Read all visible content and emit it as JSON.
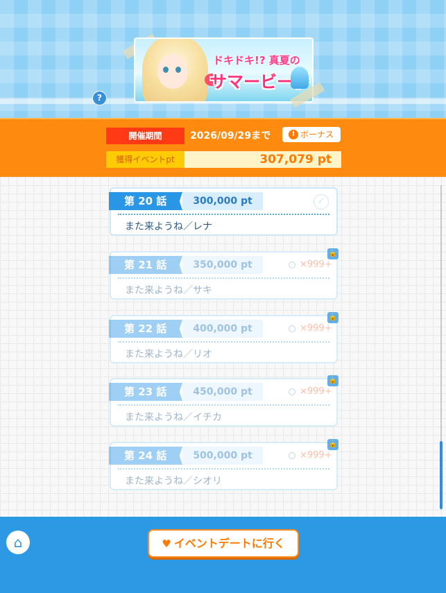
{
  "header": {
    "banner_title_line1": "ドキドキ!? 真夏の",
    "banner_title_line2": "サマービーチ",
    "help_label": "?"
  },
  "period": {
    "period_label": "開催期間",
    "period_value": "2026/09/29まで",
    "bonus_label": "ボーナス",
    "points_label": "獲得イベントpt",
    "points_value": "307,079 pt"
  },
  "episodes": [
    {
      "number": "第 20 話",
      "points": "300,000 pt",
      "title": "また来ようね／レナ",
      "state": "completed"
    },
    {
      "number": "第 21 話",
      "points": "350,000 pt",
      "title": "また来ようね／サキ",
      "state": "locked",
      "reward": "×999+"
    },
    {
      "number": "第 22 話",
      "points": "400,000 pt",
      "title": "また来ようね／リオ",
      "state": "locked",
      "reward": "×999+"
    },
    {
      "number": "第 23 話",
      "points": "450,000 pt",
      "title": "また来ようね／イチカ",
      "state": "locked",
      "reward": "×999+"
    },
    {
      "number": "第 24 話",
      "points": "500,000 pt",
      "title": "また来ようね／シオリ",
      "state": "locked",
      "reward": "×999+"
    }
  ],
  "footer": {
    "home_icon": "home-icon",
    "date_button_label": "イベントデートに行く"
  },
  "colors": {
    "accent_orange": "#fe8b0f",
    "primary_blue": "#2a96e6"
  }
}
